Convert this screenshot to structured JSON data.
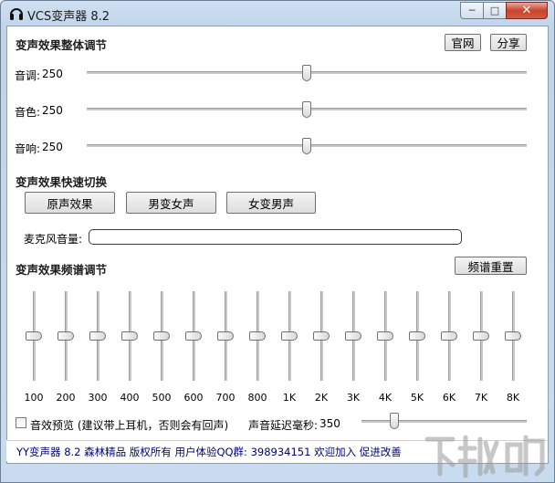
{
  "window": {
    "title": "VCS变声器 8.2",
    "controls": {
      "minimize": "─",
      "maximize": "□",
      "close": "✕"
    }
  },
  "overall": {
    "heading": "变声效果整体调节",
    "official_btn": "官网",
    "share_btn": "分享",
    "sliders": [
      {
        "label": "音调:",
        "value": "250",
        "level": 0.5
      },
      {
        "label": "音色:",
        "value": "250",
        "level": 0.5
      },
      {
        "label": "音响:",
        "value": "250",
        "level": 0.5
      }
    ]
  },
  "quick": {
    "heading": "变声效果快速切换",
    "buttons": [
      "原声效果",
      "男变女声",
      "女变男声"
    ]
  },
  "mic": {
    "label": "麦克风音量:",
    "level": 0
  },
  "eq": {
    "heading": "变声效果频谱调节",
    "reset_btn": "频谱重置",
    "bands": [
      "100",
      "200",
      "300",
      "400",
      "500",
      "600",
      "700",
      "800",
      "1K",
      "2K",
      "3K",
      "4K",
      "5K",
      "6K",
      "7K",
      "8K"
    ],
    "levels": [
      0.5,
      0.5,
      0.5,
      0.5,
      0.5,
      0.5,
      0.5,
      0.5,
      0.5,
      0.5,
      0.5,
      0.5,
      0.5,
      0.5,
      0.5,
      0.5
    ]
  },
  "preview": {
    "checkbox_label": "音效预览 (建议带上耳机，否则会有回声)",
    "checked": false,
    "delay_label": "声音延迟毫秒:",
    "delay_value": "350",
    "delay_level": 0.2
  },
  "status": "YY变声器 8.2 森林精品 版权所有 用户体验QQ群: 398934151 欢迎加入 促进改善",
  "watermark": "下载吧",
  "colors": {
    "status_text": "#000080",
    "title_bar": "#c0d4ea",
    "close_button": "#c8452f"
  },
  "icons": {
    "app": "headphones-icon"
  }
}
